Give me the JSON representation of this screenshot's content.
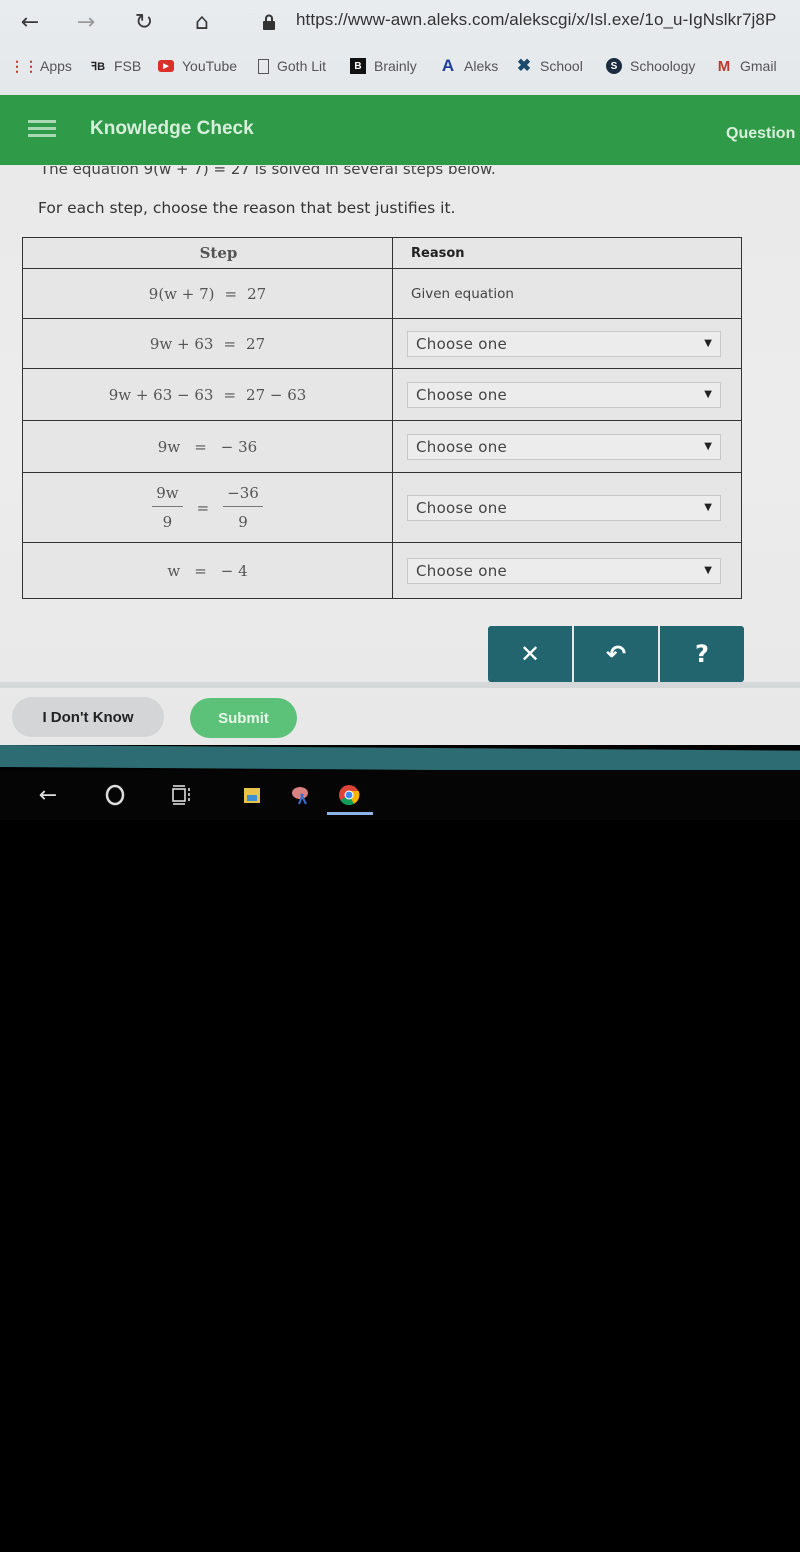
{
  "browser": {
    "url": "https://www-awn.aleks.com/alekscgi/x/Isl.exe/1o_u-IgNslkr7j8P",
    "bookmarks": [
      {
        "label": "Apps",
        "icon": "apps-grid-icon"
      },
      {
        "label": "FSB",
        "icon": "fsb-icon"
      },
      {
        "label": "YouTube",
        "icon": "youtube-icon"
      },
      {
        "label": "Goth Lit",
        "icon": "document-icon"
      },
      {
        "label": "Brainly",
        "icon": "brainly-icon"
      },
      {
        "label": "Aleks",
        "icon": "aleks-icon"
      },
      {
        "label": "School",
        "icon": "school-icon"
      },
      {
        "label": "Schoology",
        "icon": "schoology-icon"
      },
      {
        "label": "Gmail",
        "icon": "gmail-icon"
      }
    ]
  },
  "header": {
    "title": "Knowledge Check",
    "right_label": "Question"
  },
  "prompt": {
    "intro": "The equation 9(w + 7) = 27 is solved in several steps below.",
    "instruction": "For each step, choose the reason that best justifies it."
  },
  "table": {
    "headers": {
      "step": "Step",
      "reason": "Reason"
    },
    "rows": [
      {
        "step": {
          "lhs": "9(w + 7)",
          "rhs": "27"
        },
        "reason_text": "Given equation"
      },
      {
        "step": {
          "lhs": "9w + 63",
          "rhs": "27"
        },
        "reason_select": "Choose one"
      },
      {
        "step": {
          "lhs": "9w + 63 − 63",
          "rhs": "27 − 63"
        },
        "reason_select": "Choose one"
      },
      {
        "step": {
          "lhs": "9w",
          "rhs": "− 36"
        },
        "reason_select": "Choose one"
      },
      {
        "step": {
          "lhs_num": "9w",
          "lhs_den": "9",
          "rhs_num": "−36",
          "rhs_den": "9"
        },
        "reason_select": "Choose one"
      },
      {
        "step": {
          "lhs": "w",
          "rhs": "− 4"
        },
        "reason_select": "Choose one"
      }
    ]
  },
  "tools": {
    "clear": "✕",
    "undo": "↶",
    "help": "?"
  },
  "actions": {
    "dont_know": "I Don't Know",
    "submit": "Submit"
  },
  "colors": {
    "header_green": "#2f9a47",
    "tool_teal": "#22656f",
    "submit_green": "#5cc27a"
  }
}
